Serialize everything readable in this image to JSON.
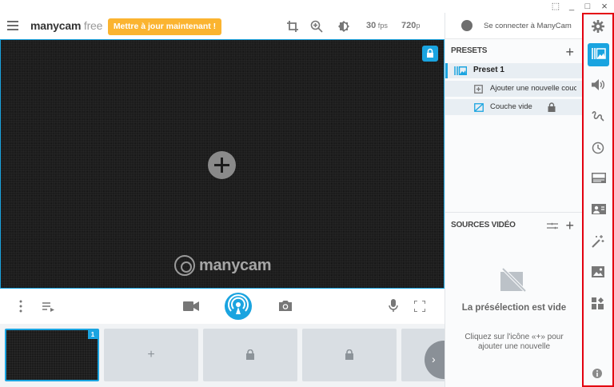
{
  "window": {
    "buttons": [
      "⬚",
      "_",
      "□",
      "×"
    ]
  },
  "header": {
    "logo_main": "manycam",
    "logo_free": " free",
    "upgrade_label": "Mettre à jour maintenant !",
    "fps_value": "30",
    "fps_unit": " fps",
    "res_value": "720",
    "res_unit": "p"
  },
  "preview": {
    "watermark": "manycam"
  },
  "strip": {
    "active_number": "1",
    "add_symbol": "+",
    "next_symbol": "›"
  },
  "right_panel": {
    "signin_label": "Se connecter à ManyCam",
    "presets_title": "PRESETS",
    "presets_add": "+",
    "preset_name": "Preset 1",
    "add_layer_label": "Ajouter une nouvelle couche",
    "empty_layer_label": "Couche vide",
    "video_sources_title": "SOURCES VIDÉO",
    "video_sources_add": "+",
    "empty_title": "La présélection est vide",
    "empty_desc": "Cliquez sur l'icône «+» pour ajouter une nouvelle"
  },
  "colors": {
    "accent": "#1aa4e0",
    "upgrade": "#fbb430",
    "highlight_border": "#e3000f"
  },
  "sidebar_icons": [
    "gear-icon",
    "presets-icon",
    "audio-icon",
    "drawing-icon",
    "clock-icon",
    "lower-thirds-icon",
    "chroma-icon",
    "effects-icon",
    "image-icon",
    "widgets-icon",
    "info-icon"
  ]
}
